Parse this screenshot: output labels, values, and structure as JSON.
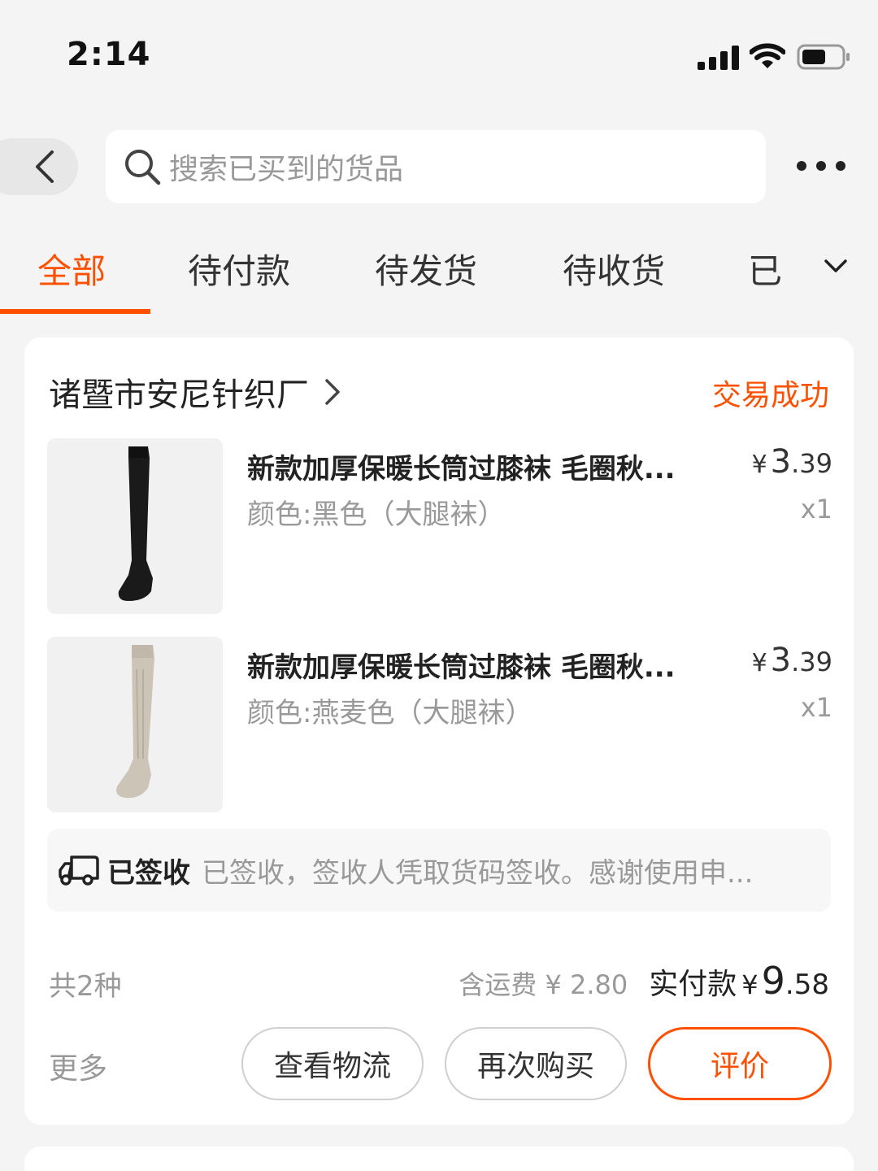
{
  "status_bar": {
    "time": "2:14"
  },
  "search": {
    "placeholder": "搜索已买到的货品"
  },
  "tabs": [
    {
      "label": "全部",
      "active": true
    },
    {
      "label": "待付款",
      "active": false
    },
    {
      "label": "待发货",
      "active": false
    },
    {
      "label": "待收货",
      "active": false
    },
    {
      "label": "已",
      "active": false
    }
  ],
  "order": {
    "shop_name": "诸暨市安尼针织厂",
    "status": "交易成功",
    "items": [
      {
        "title": "新款加厚保暖长筒过膝袜 毛圈秋...",
        "sku": "颜色:黑色（大腿袜）",
        "price_currency": "¥",
        "price_int": "3",
        "price_dec": ".39",
        "quantity": "x1",
        "image": "black-knee-high-sock"
      },
      {
        "title": "新款加厚保暖长筒过膝袜 毛圈秋...",
        "sku": "颜色:燕麦色（大腿袜）",
        "price_currency": "¥",
        "price_int": "3",
        "price_dec": ".39",
        "quantity": "x1",
        "image": "oatmeal-knee-high-sock"
      }
    ],
    "logistics": {
      "status": "已签收",
      "detail": "已签收，签收人凭取货码签收。感谢使用申..."
    },
    "item_count": "共2种",
    "shipping": "含运费 ¥ 2.80",
    "paid_label": "实付款",
    "paid_currency": "¥",
    "paid_int": "9",
    "paid_dec": ".58",
    "more_label": "更多",
    "buttons": {
      "logistics": "查看物流",
      "rebuy": "再次购买",
      "review": "评价"
    }
  },
  "colors": {
    "accent": "#ff5000",
    "background": "#f4f4f4",
    "secondary_text": "#999999"
  }
}
